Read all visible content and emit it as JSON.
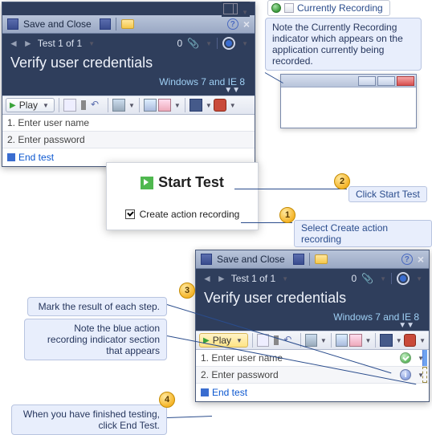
{
  "rec_badge": {
    "label": "Currently Recording"
  },
  "callout_top": {
    "text": "Note the Currently Recording indicator which appears on the application currently being recorded."
  },
  "badges": {
    "n1": "1",
    "n2": "2",
    "n3": "3",
    "n4": "4"
  },
  "labels": {
    "click_start_test": "Click Start Test",
    "select_create_recording": "Select Create action recording",
    "mark_result": "Mark the result of each step.",
    "note_blue_strip": "Note the blue action recording indicator section that appears",
    "end_test_note": "When you have finished testing, click End Test."
  },
  "start_popup": {
    "title": "Start Test",
    "checkbox_label": "Create action recording"
  },
  "window": {
    "save_close": "Save and Close",
    "nav": {
      "counter": "Test 1 of 1",
      "count0": "0"
    },
    "title": "Verify user credentials",
    "config": "Windows 7 and IE 8",
    "toolbar": {
      "play": "Play"
    },
    "steps": {
      "s1": "1. Enter user name",
      "s2": "2. Enter password",
      "end": "End test"
    }
  },
  "window2": {
    "steps": {
      "s1": "1. Enter user name",
      "s2": "2. Enter password",
      "end": "End test"
    }
  }
}
